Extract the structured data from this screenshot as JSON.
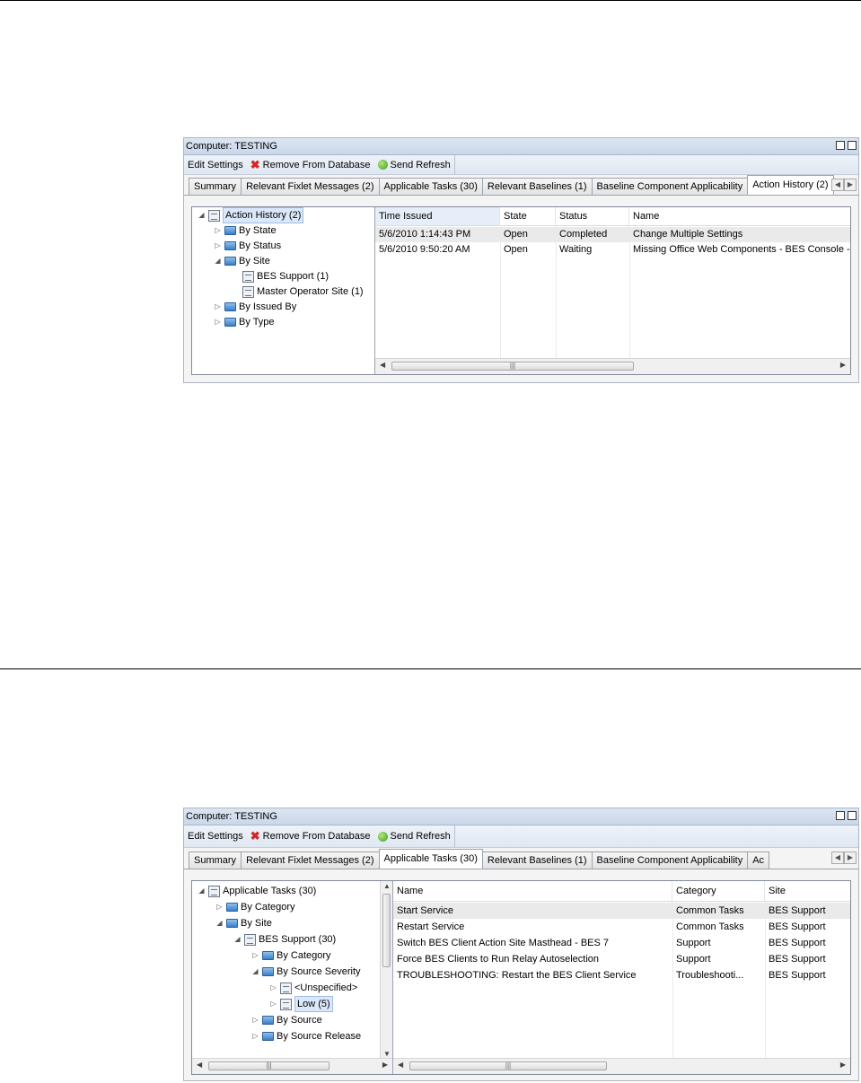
{
  "panels": [
    {
      "title": "Computer: TESTING",
      "toolbar": {
        "edit": "Edit Settings",
        "remove": "Remove From Database",
        "refresh": "Send Refresh"
      },
      "tabs": [
        "Summary",
        "Relevant Fixlet Messages (2)",
        "Applicable Tasks (30)",
        "Relevant Baselines (1)",
        "Baseline Component Applicability",
        "Action History (2)"
      ],
      "active_tab": "Action History (2)",
      "tree": [
        "Action History (2)",
        "By State",
        "By Status",
        "By Site",
        "BES Support (1)",
        "Master Operator Site (1)",
        "By Issued By",
        "By Type"
      ],
      "columns": [
        "Time Issued",
        "State",
        "Status",
        "Name"
      ],
      "rows": [
        [
          "5/6/2010 1:14:43 PM",
          "Open",
          "Completed",
          "Change Multiple Settings"
        ],
        [
          "5/6/2010 9:50:20 AM",
          "Open",
          "Waiting",
          "Missing Office Web Components - BES Console -"
        ]
      ]
    },
    {
      "title": "Computer: TESTING",
      "toolbar": {
        "edit": "Edit Settings",
        "remove": "Remove From Database",
        "refresh": "Send Refresh"
      },
      "tabs": [
        "Summary",
        "Relevant Fixlet Messages (2)",
        "Applicable Tasks (30)",
        "Relevant Baselines (1)",
        "Baseline Component Applicability",
        "Ac"
      ],
      "active_tab": "Applicable Tasks (30)",
      "tree": [
        "Applicable Tasks (30)",
        "By Category",
        "By Site",
        "BES Support (30)",
        "By Category",
        "By Source Severity",
        "<Unspecified>",
        "Low (5)",
        "By Source",
        "By Source Release"
      ],
      "columns": [
        "Name",
        "Category",
        "Site"
      ],
      "rows": [
        [
          "Start Service",
          "Common Tasks",
          "BES Support"
        ],
        [
          "Restart Service",
          "Common Tasks",
          "BES Support"
        ],
        [
          "Switch BES Client Action Site Masthead - BES 7",
          "Support",
          "BES Support"
        ],
        [
          "Force BES Clients to Run Relay Autoselection",
          "Support",
          "BES Support"
        ],
        [
          "TROUBLESHOOTING: Restart the BES Client Service",
          "Troubleshooti...",
          "BES Support"
        ]
      ]
    }
  ],
  "icons": {
    "remove": "red-x-icon",
    "refresh": "refresh-icon",
    "folder": "folder-icon",
    "list": "list-icon",
    "action": "action-icon"
  }
}
